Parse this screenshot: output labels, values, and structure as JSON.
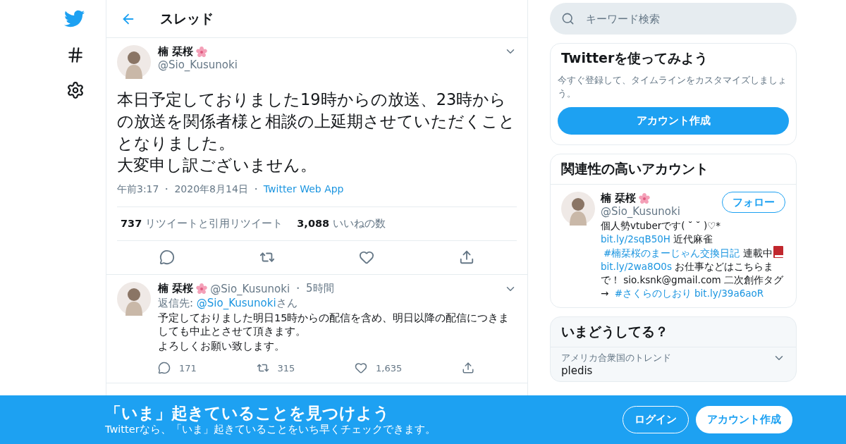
{
  "header": {
    "title": "スレッド"
  },
  "main_tweet": {
    "name": "楠 栞桜",
    "handle": "@Sio_Kusunoki",
    "text": [
      "本日予定しておりました19時からの放送、23時からの放送を関係者様と相談の上延期させていただくこととなりました。",
      "大変申し訳ございません。"
    ],
    "meta": [
      "午前3:17",
      "・",
      "2020年8月14日",
      "・"
    ],
    "source": "Twitter Web App",
    "stats": [
      {
        "count": "737",
        "label": "リツイートと引用リツイート"
      },
      {
        "count": "3,088",
        "label": "いいねの数"
      }
    ],
    "actions": [
      {
        "kind": "reply"
      },
      {
        "kind": "retweet"
      },
      {
        "kind": "like"
      },
      {
        "kind": "share"
      }
    ]
  },
  "reply": {
    "name": "楠 栞桜",
    "handle": "@Sio_Kusunoki",
    "dot": "・",
    "age": "5時間",
    "reply_to_label": "返信先: ",
    "reply_to": "@Sio_Kusunoki",
    "reply_to_suffix": "さん",
    "text": [
      "予定しておりました明日15時からの配信を含め、明日以降の配信につきましても中止とさせて頂きます。",
      "よろしくお願い致します。"
    ],
    "actions": [
      {
        "kind": "reply",
        "count": "171"
      },
      {
        "kind": "retweet",
        "count": "315"
      },
      {
        "kind": "like",
        "count": "1,635"
      },
      {
        "kind": "share"
      }
    ]
  },
  "search": {
    "placeholder": "キーワード検索"
  },
  "signup_card": {
    "title": "Twitterを使ってみよう",
    "text": "今すぐ登録して、タイムラインをカスタマイズしましょう。",
    "button": "アカウント作成"
  },
  "related": {
    "title": "関連性の高いアカウント",
    "account": {
      "name": "楠 栞桜",
      "handle": "@Sio_Kusunoki",
      "follow": "フォロー",
      "bio": [
        {
          "kind": "text",
          "text": "個人勢vtuberです( ˘ ˘ )♡* "
        },
        {
          "kind": "link",
          "text": "bit.ly/2sqB50H"
        },
        {
          "kind": "text",
          "text": " 近代麻雀 "
        },
        {
          "kind": "link",
          "text": "#楠栞桜のまーじゃん交換日記"
        },
        {
          "kind": "text",
          "text": " 連載中"
        },
        {
          "kind": "book"
        },
        {
          "kind": "link",
          "text": "bit.ly/2wa8O0s"
        },
        {
          "kind": "text",
          "text": " お仕事などはこちらまで！ sio.ksnk@gmail.com 二次創作タグ → "
        },
        {
          "kind": "link",
          "text": "#さくらのしおり"
        },
        {
          "kind": "link",
          "text": "bit.ly/39a6aoR"
        }
      ]
    }
  },
  "trends": {
    "title": "いまどうしてる？",
    "items": [
      {
        "context": "アメリカ合衆国のトレンド",
        "name": "pledis"
      }
    ]
  },
  "banner": {
    "title": "「いま」起きていることを見つけよう",
    "subtitle": "Twitterなら、「いま」起きていることをいち早くチェックできます。",
    "login": "ログイン",
    "signup": "アカウント作成"
  }
}
